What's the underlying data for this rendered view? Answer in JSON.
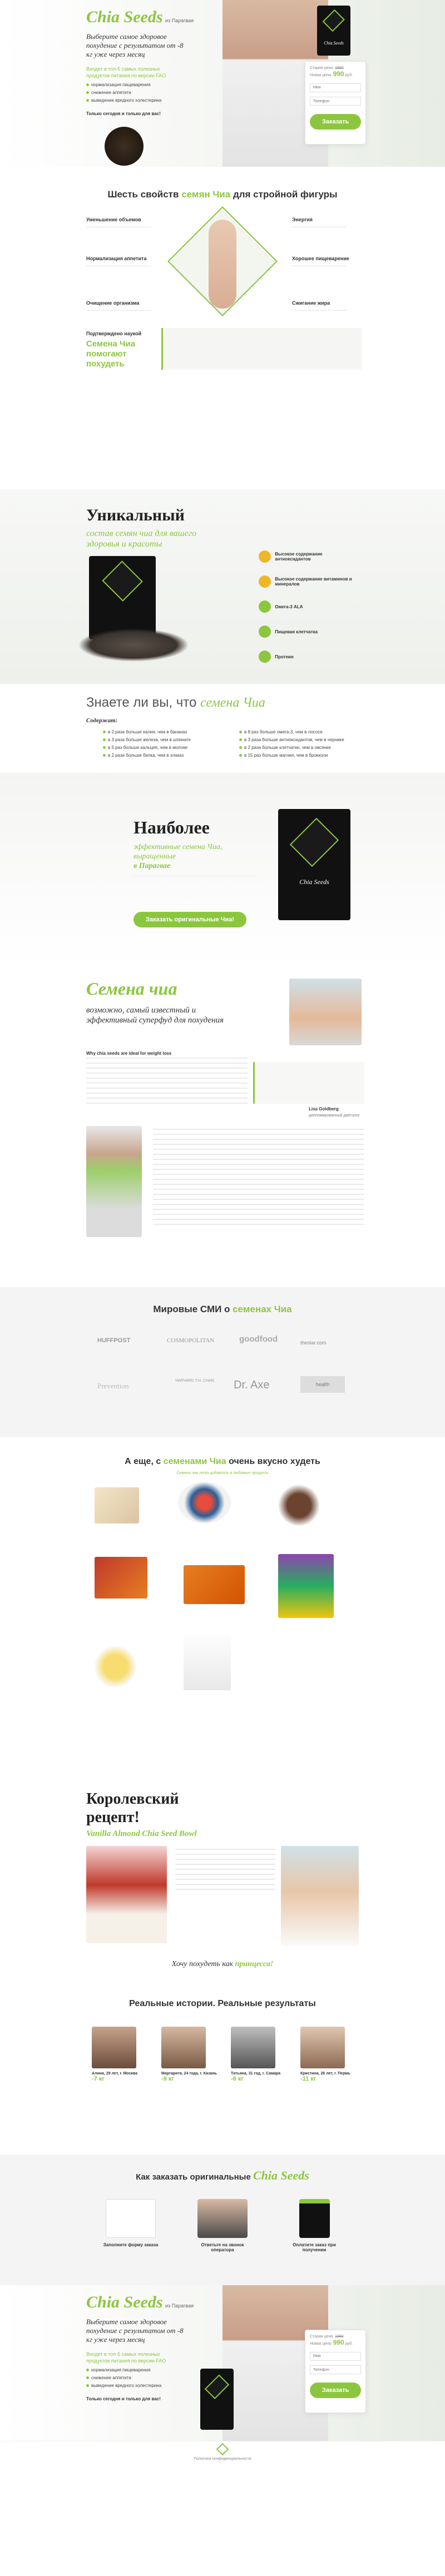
{
  "hero": {
    "brand": "Chia Seeds",
    "brand_sub": "из Парагвая",
    "tagline": "Выберите самое здоровое похудение с результатом от -8 кг уже через месяц",
    "note": "Входит в топ-5 самых полезных продуктов питания по версии FAO",
    "bullets": [
      "нормализация пищеварения",
      "снижение аппетита",
      "выведение вредного холестерина"
    ],
    "promo": "Только сегодня и только для вас!",
    "price_old_label": "Старая цена:",
    "price_old": "1980",
    "price_new_label": "Новая цена:",
    "price_new": "990",
    "currency": "руб.",
    "name_placeholder": "Имя",
    "phone_placeholder": "Телефон",
    "order_button": "Заказать",
    "pack_label": "Chia Seeds"
  },
  "six": {
    "title_a": "Шесть свойств ",
    "title_b": "семян Чиа",
    "title_c": " для стройной фигуры",
    "left": [
      "Уменьшение объемов",
      "Нормализация аппетита",
      "Очищение организма"
    ],
    "right": [
      "Энергия",
      "Хорошее пищеварение",
      "Сжигание жира"
    ],
    "proof_label": "Подтверждено наукой",
    "proof_big": "Семена Чиа помогают похудеть"
  },
  "unique": {
    "title": "Уникальный",
    "subtitle": "состав семян чиа для вашего здоровья и красоты",
    "items": [
      "Высокое содержание антиоксидантов",
      "Высокое содержание витаминов и минералов",
      "Омега-3 ALA",
      "Пищевая клетчатка",
      "Протеин"
    ]
  },
  "know": {
    "title_a": "Знаете ли вы, что ",
    "title_b": "семена Чиа",
    "contains": "Содержат:",
    "left": [
      "в 2 раза больше калия, чем в бананах",
      "в 3 раза больше железа, чем в шпинате",
      "в 5 раз больше кальция, чем в молоке",
      "в 2 раза больше белка, чем в злаках"
    ],
    "right": [
      "в 8 раз больше омега-3, чем в лососе",
      "в 3 раза больше антиоксидантов, чем в чернике",
      "в 2 раза больше клетчатки, чем в овсянке",
      "в 15 раз больше магния, чем в брокколи"
    ]
  },
  "most": {
    "title": "Наиболее",
    "sub_a": "эффективные семена Чиа,",
    "sub_b": "выращенные",
    "sub_c": "в Парагвае",
    "button": "Заказать оригинальные Чиа!"
  },
  "seeds": {
    "title": "Семена чиа",
    "subtitle": "возможно, самый известный и эффективный суперфуд для похудения",
    "why": "Why chia seeds are ideal for weight loss",
    "quote_name": "Lisa Goldberg",
    "quote_role": "дипломированный диетолог"
  },
  "media": {
    "title_a": "Мировые СМИ о ",
    "title_b": "семенах Чиа",
    "logos": [
      "HUFFPOST",
      "COSMOPOLITAN",
      "goodfood",
      "thestar.com",
      "Prevention",
      "HARVARD T.H. CHAN",
      "Dr. Axe",
      "health"
    ]
  },
  "tasty": {
    "title_a": "А еще, с ",
    "title_b": "семенами Чиа",
    "title_c": " очень вкусно худеть",
    "sub": "Семена чиа легко добавлять в любимые продукты"
  },
  "recipe": {
    "title_a": "Королевский",
    "title_b": "рецепт!",
    "subtitle": "Vanilla Almond Chia Seed Bowl",
    "footer_a": "Хочу похудеть как ",
    "footer_b": "принцесса!"
  },
  "stories": {
    "title": "Реальные истории. Реальные результаты",
    "people": [
      "Алина, 29 лет, г. Москва",
      "Маргарита, 24 года, г. Казань",
      "Татьяна, 31 год, г. Самара",
      "Кристина, 26 лет, г. Пермь"
    ],
    "results": [
      "-7 кг",
      "-9 кг",
      "-6 кг",
      "-11 кг"
    ]
  },
  "order": {
    "title_a": "Как заказать оригинальные ",
    "title_b": "Chia Seeds",
    "steps": [
      "Заполните форму заказа",
      "Ответьте на звонок оператора",
      "Оплатите заказ при получении"
    ]
  },
  "footer": {
    "text": "Политика конфиденциальности"
  },
  "colors": {
    "accent": "#8cc63f",
    "dark": "#1b1b1b"
  }
}
